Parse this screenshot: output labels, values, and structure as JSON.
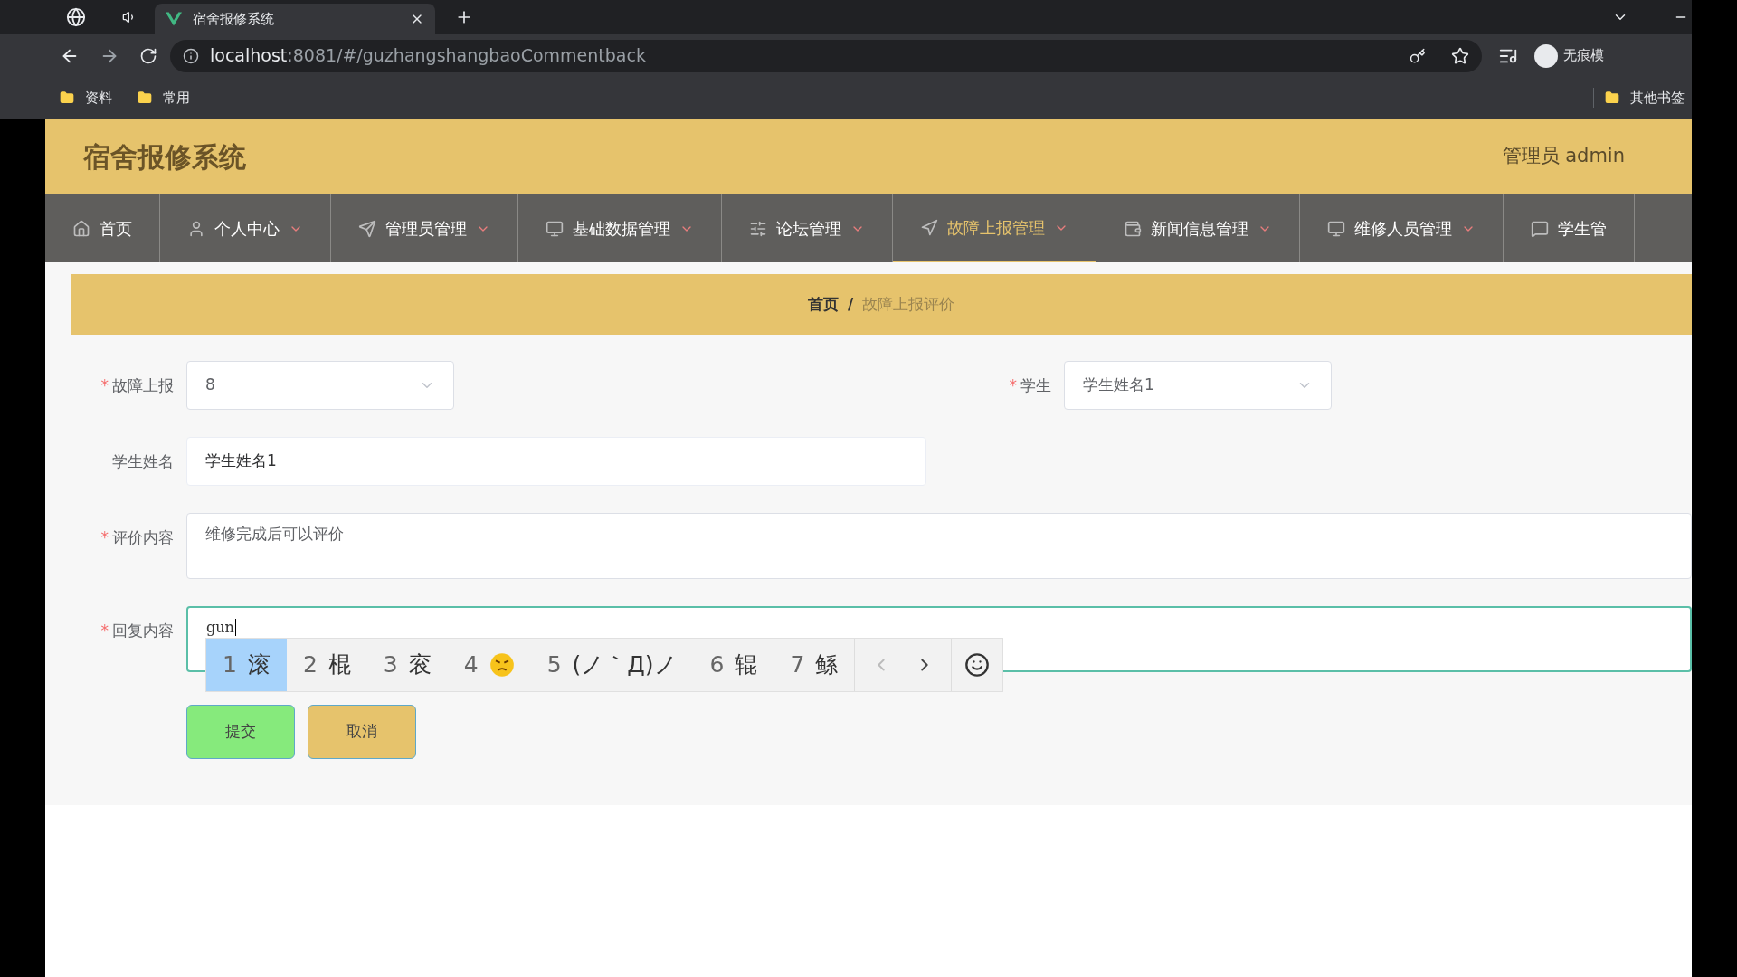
{
  "browser": {
    "tabs": [
      {
        "title": "宿舍报修系统",
        "selected": true
      }
    ],
    "address": {
      "host": "localhost",
      "path": ":8081/#/guzhangshangbaoCommentback"
    },
    "profile_label": "无痕模",
    "bookmarks": [
      "资料",
      "常用"
    ],
    "other_bookmarks": "其他书签"
  },
  "header": {
    "title": "宿舍报修系统",
    "user": "管理员 admin"
  },
  "nav": [
    {
      "label": "首页",
      "caret": false,
      "selected": false
    },
    {
      "label": "个人中心",
      "caret": true,
      "selected": false
    },
    {
      "label": "管理员管理",
      "caret": true,
      "selected": false
    },
    {
      "label": "基础数据管理",
      "caret": true,
      "selected": false
    },
    {
      "label": "论坛管理",
      "caret": true,
      "selected": false
    },
    {
      "label": "故障上报管理",
      "caret": true,
      "selected": true
    },
    {
      "label": "新闻信息管理",
      "caret": true,
      "selected": false
    },
    {
      "label": "维修人员管理",
      "caret": true,
      "selected": false
    },
    {
      "label": "学生管",
      "caret": false,
      "selected": false
    }
  ],
  "breadcrumb": {
    "items": [
      "首页",
      "故障上报评价"
    ],
    "separator": "/"
  },
  "form": {
    "required_mark": "*",
    "rows": [
      {
        "fields": [
          {
            "kind": "select",
            "label": "故障上报",
            "required": true,
            "value": "8"
          },
          {
            "kind": "select",
            "label": "学生",
            "required": true,
            "value": "学生姓名1"
          }
        ]
      },
      {
        "fields": [
          {
            "kind": "input",
            "label": "学生姓名",
            "required": false,
            "value": "学生姓名1"
          }
        ]
      },
      {
        "fields": [
          {
            "kind": "textarea",
            "label": "评价内容",
            "required": true,
            "value": "维修完成后可以评价",
            "focused": false
          }
        ]
      },
      {
        "fields": [
          {
            "kind": "textarea",
            "label": "回复内容",
            "required": true,
            "value": "gun",
            "focused": true
          }
        ]
      }
    ],
    "buttons": [
      {
        "label": "提交",
        "kind": "submit"
      },
      {
        "label": "取消",
        "kind": "cancel"
      }
    ]
  },
  "ime": {
    "candidates": [
      {
        "number": "1",
        "kind": "text",
        "text": "滚",
        "selected": true
      },
      {
        "number": "2",
        "kind": "text",
        "text": "棍",
        "selected": false
      },
      {
        "number": "3",
        "kind": "text",
        "text": "衮",
        "selected": false
      },
      {
        "number": "4",
        "kind": "emoji",
        "selected": false
      },
      {
        "number": "5",
        "kind": "text",
        "text": "(ノ｀Д)ノ",
        "selected": false
      },
      {
        "number": "6",
        "kind": "text",
        "text": "辊",
        "selected": false
      },
      {
        "number": "7",
        "kind": "text",
        "text": "鲧",
        "selected": false
      }
    ]
  }
}
